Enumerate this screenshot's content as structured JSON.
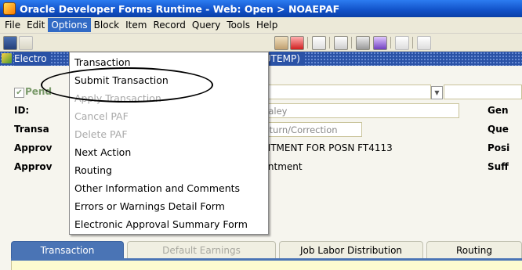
{
  "window": {
    "title": "Oracle Developer Forms Runtime - Web:  Open > NOAEPAF"
  },
  "menubar": {
    "items": [
      "File",
      "Edit",
      "Options",
      "Block",
      "Item",
      "Record",
      "Query",
      "Tools",
      "Help"
    ],
    "active": "Options"
  },
  "form_header": {
    "title": "Electro",
    "form_code": "(XUTEMP)"
  },
  "form": {
    "pending_label": "Pend",
    "id_label": "ID:",
    "transaction_label": "Transa",
    "approval1_label": "Approv",
    "approval2_label": "Approv",
    "name_value": "O Haley",
    "return_value": "Return/Correction",
    "appointment_text": "POINTMENT FOR POSN FT4113",
    "appointment2_text": "ppointment",
    "right_labels": [
      "Gen",
      "Que",
      "Posi",
      "Suff"
    ]
  },
  "options_menu": {
    "items": [
      {
        "label": "Transaction",
        "enabled": true
      },
      {
        "label": "Submit Transaction",
        "enabled": true
      },
      {
        "label": "Apply Transaction",
        "enabled": false
      },
      {
        "label": "Cancel PAF",
        "enabled": false
      },
      {
        "label": "Delete PAF",
        "enabled": false
      },
      {
        "label": "Next Action",
        "enabled": true
      },
      {
        "label": "Routing",
        "enabled": true
      },
      {
        "label": "Other Information and Comments",
        "enabled": true
      },
      {
        "label": "Errors or Warnings Detail Form",
        "enabled": true
      },
      {
        "label": "Electronic Approval Summary Form",
        "enabled": true
      }
    ],
    "highlighted": "Submit Transaction"
  },
  "tabs": [
    {
      "label": "Transaction",
      "state": "active"
    },
    {
      "label": "Default Earnings",
      "state": "disabled"
    },
    {
      "label": "Job Labor Distribution",
      "state": "inactive"
    },
    {
      "label": "Routing",
      "state": "inactive"
    }
  ],
  "colors": {
    "title_bar": "#1151c8",
    "menu_highlight": "#316ac5",
    "active_tab": "#4a74b5"
  }
}
